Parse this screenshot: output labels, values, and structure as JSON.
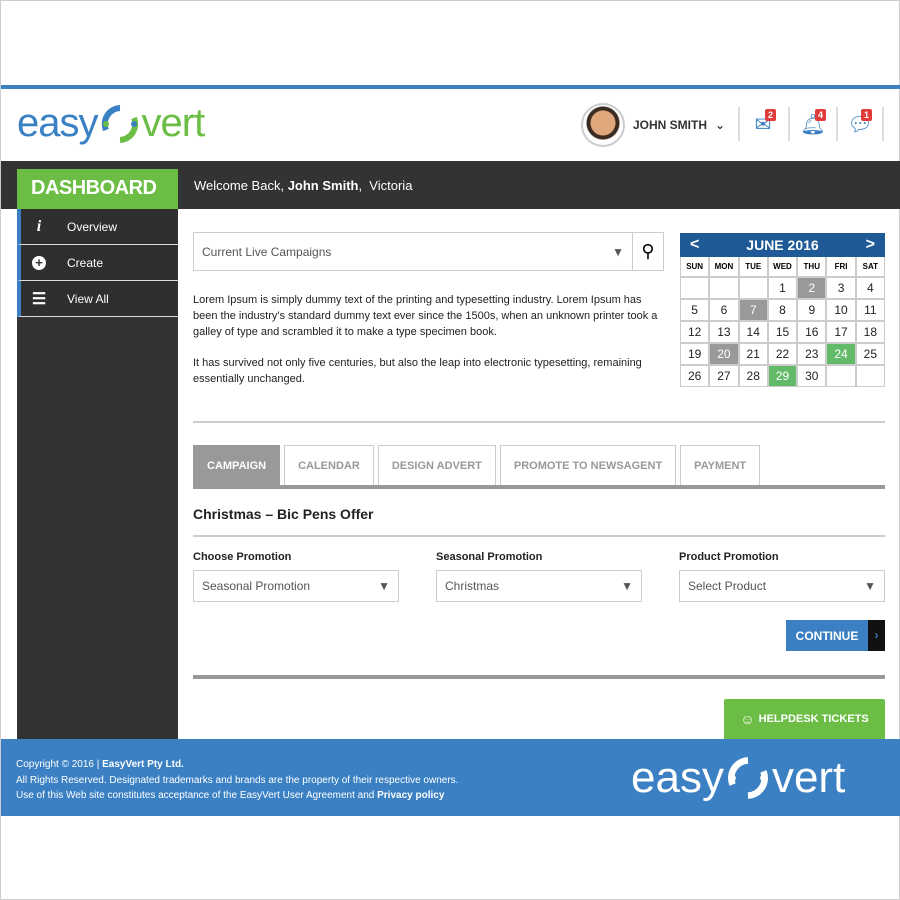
{
  "brand": {
    "logo_left": "easy",
    "logo_right": "vert",
    "colors": {
      "blue": "#3a80c3",
      "green": "#6cbd45",
      "dark": "#333333"
    }
  },
  "header": {
    "user_name": "JOHN SMITH",
    "icons": [
      {
        "name": "mail-icon",
        "badge": "2"
      },
      {
        "name": "bell-icon",
        "badge": "4"
      },
      {
        "name": "chat-icon",
        "badge": "1"
      }
    ]
  },
  "topbar": {
    "dashboard": "DASHBOARD",
    "welcome_prefix": "Welcome Back, ",
    "welcome_name": "John Smith",
    "welcome_suffix": ",  Victoria"
  },
  "sidebar": {
    "items": [
      {
        "icon": "i",
        "label": "Overview"
      },
      {
        "icon": "+",
        "label": "Create"
      },
      {
        "icon": "☰",
        "label": "View All"
      }
    ]
  },
  "campaign_select": {
    "value": "Current Live Campaigns"
  },
  "paragraphs": [
    "Lorem Ipsum is simply dummy text of the printing and typesetting industry. Lorem Ipsum has been the industry's standard dummy text ever since the 1500s, when an unknown printer took a galley of type and scrambled it to make a type specimen book.",
    "It has survived not only five centuries, but also the leap into electronic typesetting, remaining essentially unchanged."
  ],
  "calendar": {
    "title": "JUNE 2016",
    "day_names": [
      "SUN",
      "MON",
      "TUE",
      "WED",
      "THU",
      "FRI",
      "SAT"
    ],
    "leading_blanks": 3,
    "days": 30,
    "gray_days": [
      2,
      7,
      20
    ],
    "green_days": [
      24,
      29
    ]
  },
  "tabs": [
    {
      "label": "CAMPAIGN",
      "active": true
    },
    {
      "label": "CALENDAR"
    },
    {
      "label": "DESIGN ADVERT"
    },
    {
      "label": "PROMOTE TO NEWSAGENT"
    },
    {
      "label": "PAYMENT"
    }
  ],
  "form": {
    "title": "Christmas – Bic Pens Offer",
    "fields": [
      {
        "label": "Choose Promotion",
        "value": "Seasonal Promotion"
      },
      {
        "label": "Seasonal Promotion",
        "value": "Christmas"
      },
      {
        "label": "Product Promotion",
        "value": "Select Product"
      }
    ],
    "continue": "CONTINUE"
  },
  "helpdesk": "HELPDESK TICKETS",
  "footer": {
    "line1_a": "Copyright © 2016 | ",
    "line1_b": "EasyVert Pty Ltd.",
    "line2": "All Rights Reserved. Designated trademarks and brands are the property of their respective owners.",
    "line3_a": "Use of this Web site constitutes acceptance of the EasyVert User Agreement and ",
    "line3_b": "Privacy policy"
  }
}
